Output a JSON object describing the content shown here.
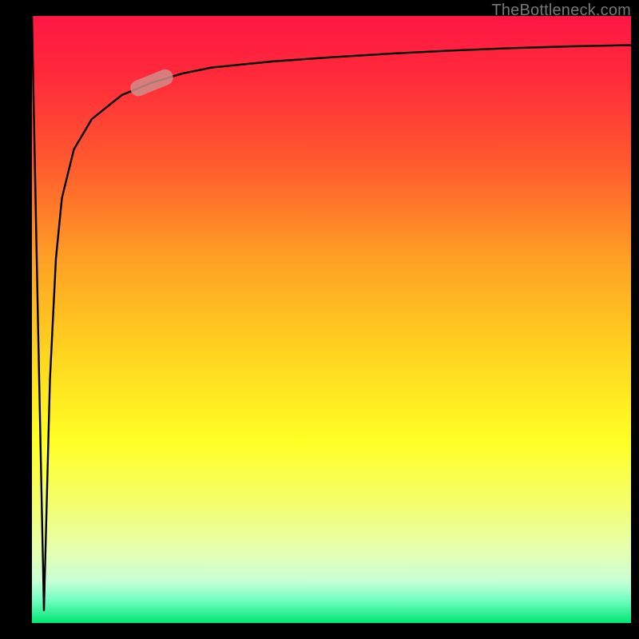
{
  "source_label": "TheBottleneck.com",
  "colors": {
    "frame_bg": "#000000",
    "top": "#ff1744",
    "mid_upper": "#ffa024",
    "mid": "#ffff24",
    "bottom": "#00e676",
    "curve": "#000000",
    "marker_fill": "#d08d8a",
    "marker_glow": "#e5a9a8"
  },
  "chart_data": {
    "type": "line",
    "title": "",
    "xlabel": "",
    "ylabel": "",
    "xlim": [
      0,
      100
    ],
    "ylim": [
      0,
      100
    ],
    "grid": false,
    "series": [
      {
        "name": "bottleneck-curve",
        "x": [
          0,
          1,
          2,
          3,
          4,
          5,
          7,
          10,
          15,
          20,
          25,
          30,
          40,
          50,
          60,
          70,
          80,
          90,
          100
        ],
        "values": [
          100,
          50,
          2,
          40,
          60,
          70,
          78,
          83,
          87,
          89,
          90.5,
          91.5,
          92.5,
          93.2,
          93.8,
          94.3,
          94.7,
          95,
          95.2
        ]
      }
    ],
    "marker": {
      "x": 20,
      "y": 89
    }
  }
}
